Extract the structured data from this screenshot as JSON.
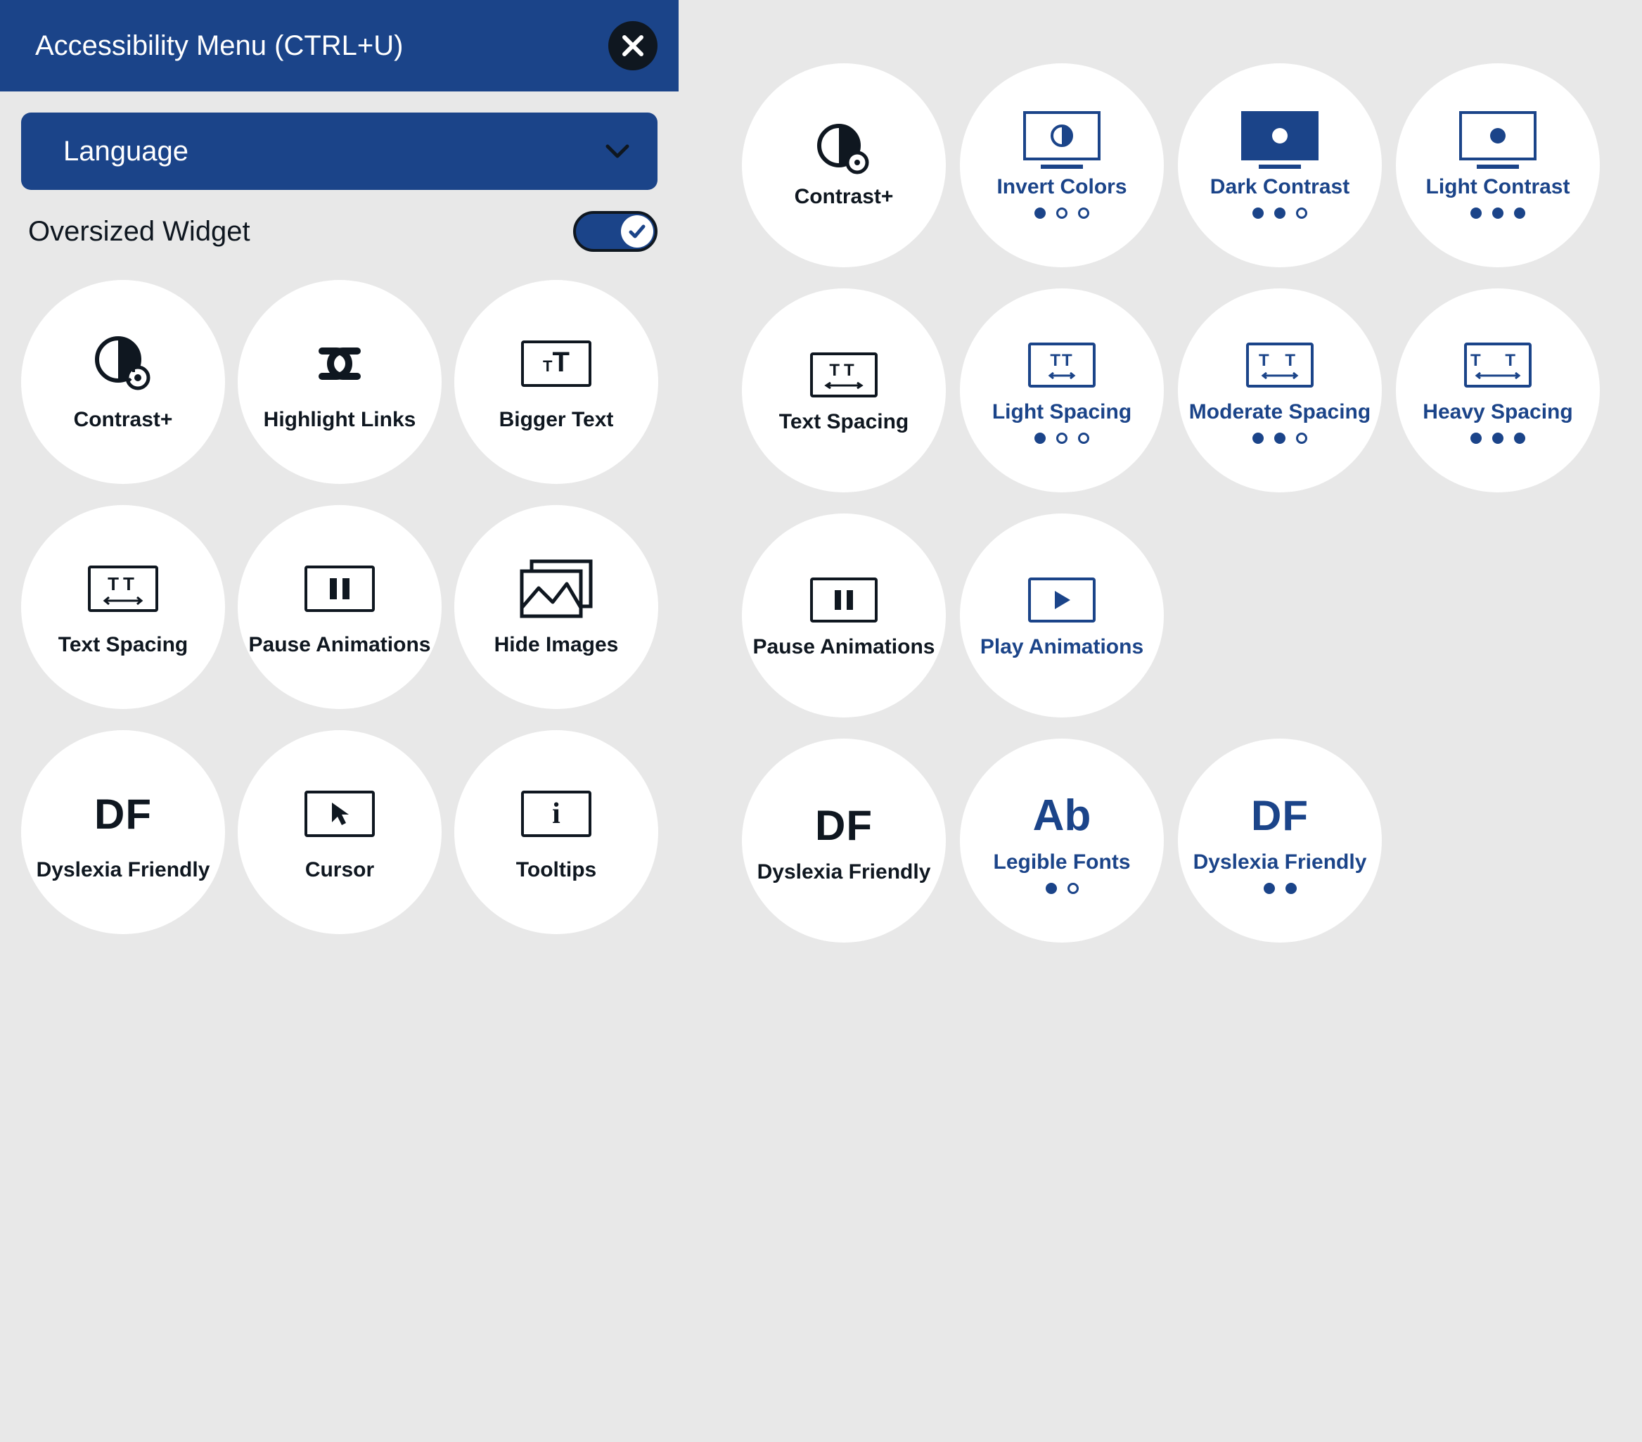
{
  "header": {
    "title": "Accessibility Menu (CTRL+U)"
  },
  "language": {
    "label": "Language"
  },
  "oversized": {
    "label": "Oversized Widget"
  },
  "left_items": [
    {
      "label": "Contrast+"
    },
    {
      "label": "Highlight Links"
    },
    {
      "label": "Bigger Text"
    },
    {
      "label": "Text Spacing"
    },
    {
      "label": "Pause Animations"
    },
    {
      "label": "Hide Images"
    },
    {
      "label": "Dyslexia Friendly"
    },
    {
      "label": "Cursor"
    },
    {
      "label": "Tooltips"
    }
  ],
  "right_rows": [
    {
      "lead": {
        "label": "Contrast+"
      },
      "opts": [
        {
          "label": "Invert Colors",
          "dots": [
            "f",
            "e",
            "e"
          ]
        },
        {
          "label": "Dark Contrast",
          "dots": [
            "f",
            "f",
            "e"
          ]
        },
        {
          "label": "Light Contrast",
          "dots": [
            "f",
            "f",
            "f"
          ]
        }
      ]
    },
    {
      "lead": {
        "label": "Text Spacing"
      },
      "opts": [
        {
          "label": "Light Spacing",
          "dots": [
            "f",
            "e",
            "e"
          ]
        },
        {
          "label": "Moderate Spacing",
          "dots": [
            "f",
            "f",
            "e"
          ]
        },
        {
          "label": "Heavy Spacing",
          "dots": [
            "f",
            "f",
            "f"
          ]
        }
      ]
    },
    {
      "lead": {
        "label": "Pause Animations"
      },
      "opts": [
        {
          "label": "Play Animations",
          "dots": []
        }
      ]
    },
    {
      "lead": {
        "label": "Dyslexia Friendly"
      },
      "opts": [
        {
          "label": "Legible Fonts",
          "dots": [
            "f",
            "e"
          ]
        },
        {
          "label": "Dyslexia Friendly",
          "dots": [
            "f",
            "f"
          ]
        }
      ]
    }
  ]
}
